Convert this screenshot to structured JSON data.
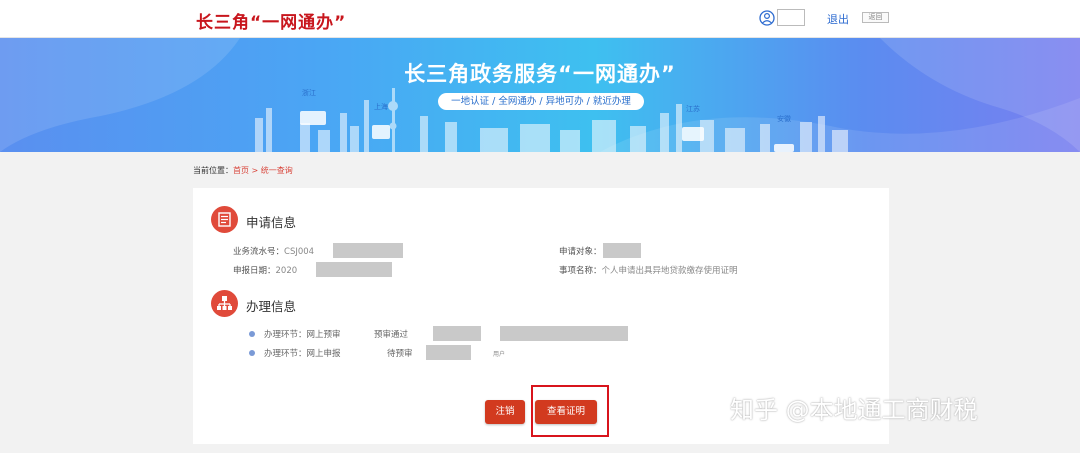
{
  "header": {
    "logo": "长三角“一网通办”",
    "logout_label": "退出",
    "back_label": "返回"
  },
  "banner": {
    "title": "长三角政务服务“一网通办”",
    "subtitle": "一地认证 / 全网通办 / 异地可办 / 就近办理",
    "tags": [
      "浙江",
      "上海",
      "江苏",
      "安徽"
    ]
  },
  "breadcrumb": {
    "prefix": "当前位置：",
    "home": "首页",
    "sep": " > ",
    "current": "统一查询"
  },
  "apply_info": {
    "title": "申请信息",
    "serial_label": "业务流水号：",
    "serial_value": "CSJ004",
    "date_label": "申报日期：",
    "date_value": "2020",
    "target_label": "申请对象：",
    "item_label": "事项名称：",
    "item_value": "个人申请出具异地贷款缴存使用证明"
  },
  "process_info": {
    "title": "办理信息",
    "rows": [
      {
        "stage": "办理环节：网上预审",
        "status": "预审通过",
        "note": ""
      },
      {
        "stage": "办理环节：网上申报",
        "status": "待预审",
        "note": "用户"
      }
    ]
  },
  "actions": {
    "cancel_label": "注销",
    "view_cert_label": "查看证明"
  },
  "watermark": "知乎 @本地通工商财税",
  "colors": {
    "brand_red": "#c8161d",
    "button_red": "#d23a1f",
    "link_blue": "#2d6bd0",
    "icon_red": "#e04a3a"
  }
}
